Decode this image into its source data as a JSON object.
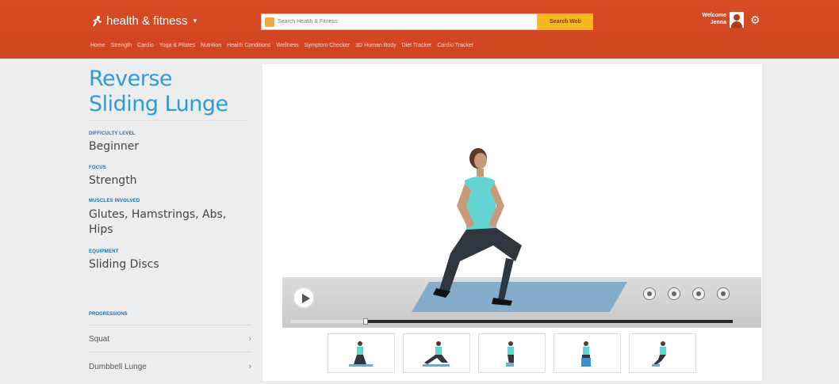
{
  "header": {
    "brand": "health & fitness",
    "brand_caret": "▾",
    "search_placeholder": "Search Health & Fitness",
    "search_button": "Search Web",
    "welcome_line1": "Welcome",
    "welcome_line2": "Jenna",
    "nav": [
      "Home",
      "Strength",
      "Cardio",
      "Yoga & Pilates",
      "Nutrition",
      "Health Conditions",
      "Wellness",
      "Symptom Checker",
      "3D Human Body",
      "Diet Tracker",
      "Cardio Tracker"
    ]
  },
  "exercise": {
    "title": "Reverse Sliding Lunge",
    "difficulty_label": "DIFFICULTY LEVEL",
    "difficulty": "Beginner",
    "focus_label": "FOCUS",
    "focus": "Strength",
    "muscles_label": "MUSCLES INVOLVED",
    "muscles": "Glutes, Hamstrings, Abs, Hips",
    "equipment_label": "EQUIPMENT",
    "equipment": "Sliding Discs"
  },
  "progressions": {
    "label": "PROGRESSIONS",
    "items": [
      {
        "label": "Squat",
        "chevron": "›"
      },
      {
        "label": "Dumbbell Lunge",
        "chevron": "›"
      }
    ]
  },
  "video": {
    "progress_fraction": 0.17,
    "controls": [
      "caption-icon",
      "info-icon",
      "hd-icon",
      "fullscreen-icon"
    ]
  },
  "colors": {
    "header": "#d94b24",
    "title": "#2d9bd4",
    "label": "#1e6db8",
    "search_button": "#f6b820"
  }
}
